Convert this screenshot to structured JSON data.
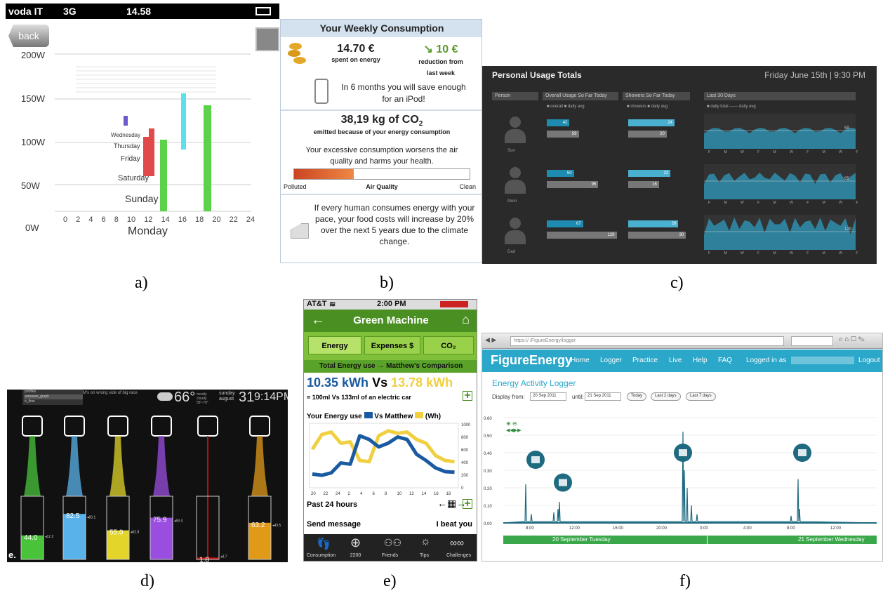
{
  "captions": [
    "a)",
    "b)",
    "c)",
    "d)",
    "e)",
    "f)"
  ],
  "panel_a": {
    "status": {
      "carrier": "voda IT",
      "network": "3G",
      "time": "14.58"
    },
    "back_label": "back",
    "y_labels": [
      "200W",
      "150W",
      "100W",
      "50W",
      "0W"
    ],
    "day_labels": [
      "Monday",
      "Sunday",
      "Saturday",
      "Friday",
      "Thursday",
      "Wednesday"
    ],
    "x_ticks": "0   2   4   6   8   10  12  14  16  18  20  22  24",
    "colors": {
      "green": "#5bd24a",
      "cyan": "#5ee0ea",
      "red": "#e04a4a",
      "purple": "#6a5acd"
    }
  },
  "panel_b": {
    "title": "Your Weekly Consumption",
    "spent_value": "14.70 €",
    "spent_label": "spent on energy",
    "reduction_value": "10 €",
    "reduction_label": "reduction from last week",
    "ipod_text": "In 6 months you will save enough for an iPod!",
    "co2_value": "38,19 kg of CO",
    "co2_sub": "2",
    "co2_label": "emitted because of your energy consumption",
    "air_text": "Your excessive consumption worsens the air quality and harms your health.",
    "air_left": "Polluted",
    "air_mid": "Air Quality",
    "air_right": "Clean",
    "air_level": 0.34,
    "food_text": "If every human consumes energy with your pace, your food costs will increase by 20% over the next 5 years due to the climate change."
  },
  "panel_c": {
    "title": "Personal Usage Totals",
    "datetime": "Friday June 15th | 9:30 PM",
    "columns": [
      "Person",
      "Overall Usage So Far Today",
      "Showers So Far Today",
      "Last 30 Days"
    ],
    "legend_overall": "■ overall  ■ daily avg",
    "legend_showers": "■ showers  ■ daily avg",
    "legend_30": "■ daily total  —— daily avg",
    "day_axis": "F M W F M W F M W F",
    "rows": [
      {
        "name": "Son",
        "overall": 42,
        "overall_avg": 59,
        "showers": 24,
        "showers_avg": 20,
        "avg30": 59
      },
      {
        "name": "Mom",
        "overall": 50,
        "overall_avg": 95,
        "showers": 22,
        "showers_avg": 16,
        "avg30": 95
      },
      {
        "name": "Dad",
        "overall": 67,
        "overall_avg": 129,
        "showers": 26,
        "showers_avg": 30,
        "avg30": 129
      }
    ]
  },
  "panel_d": {
    "menu": [
      "profiles",
      "pressure_graph",
      "b_flow"
    ],
    "news": "M's on wrong side of big race",
    "temp": "66°",
    "weather": "mostly cloudy 58°-70°",
    "day": "sunday",
    "month": "august",
    "date": "31",
    "time": "9:14PM",
    "corner": "e.",
    "tubes": [
      {
        "value": "44.0",
        "avg": "12.2",
        "level": 0.38,
        "color": "#49c43a"
      },
      {
        "value": "82.5",
        "avg": "83.1",
        "level": 0.72,
        "color": "#59b3ea"
      },
      {
        "value": "55.0",
        "avg": "52.8",
        "level": 0.46,
        "color": "#e3d52a"
      },
      {
        "value": "75.9",
        "avg": "93.4",
        "level": 0.66,
        "color": "#9a4ee0"
      },
      {
        "value": "1.8",
        "avg": "3.7",
        "level": 0.03,
        "color": "#c11"
      },
      {
        "value": "63.2",
        "avg": "43.5",
        "level": 0.58,
        "color": "#e09a18"
      }
    ]
  },
  "panel_e": {
    "status": {
      "carrier": "AT&T",
      "time": "2:00 PM"
    },
    "title": "Green Machine",
    "tabs": [
      "Energy",
      "Expenses $",
      "CO₂"
    ],
    "subtitle": "Total Energy use → Matthew's Comparison",
    "mine": "10.35 kWh",
    "vs": "Vs",
    "theirs": "13.78 kWh",
    "equiv": "= 100ml Vs 133ml of an electric car",
    "chart_title": "Your Energy use",
    "chart_vs": "Vs Matthew",
    "chart_unit": "(Wh)",
    "y_ticks": [
      "1000",
      "800",
      "600",
      "400",
      "200",
      "0"
    ],
    "x_ticks": [
      "20",
      "22",
      "24",
      "2",
      "4",
      "6",
      "8",
      "10",
      "12",
      "14",
      "16",
      "18"
    ],
    "past": "Past 24 hours",
    "send": "Send message",
    "beat": "I beat you",
    "nav": [
      "Consumption",
      "2200",
      "Friends",
      "Tips",
      "Challenges"
    ],
    "colors": {
      "you": "#1a5aa0",
      "matthew": "#f0d040"
    }
  },
  "panel_f": {
    "url": "https://                             /FigureEnergy/logger",
    "nav": [
      "FigureEnergy",
      "Home",
      "Logger",
      "Practice",
      "Live",
      "Help",
      "FAQ",
      "Logged in as",
      "Logout"
    ],
    "page_title": "Energy Activity Logger",
    "display_from": "Display from:",
    "from_value": "20 Sep 2011",
    "until": "until:",
    "until_value": "21 Sep 2011",
    "buttons": [
      "Today",
      "Last 2 days",
      "Last 7 days"
    ],
    "y_ticks": [
      "0.60",
      "0.50",
      "0.40",
      "0.30",
      "0.20",
      "0.10",
      "0.00"
    ],
    "x_ticks": [
      "8:00",
      "12:00",
      "16:00",
      "20:00",
      "0:00",
      "4:00",
      "8:00",
      "12:00"
    ],
    "days": [
      "20 September Tuesday",
      "21 September Wednesday"
    ]
  }
}
